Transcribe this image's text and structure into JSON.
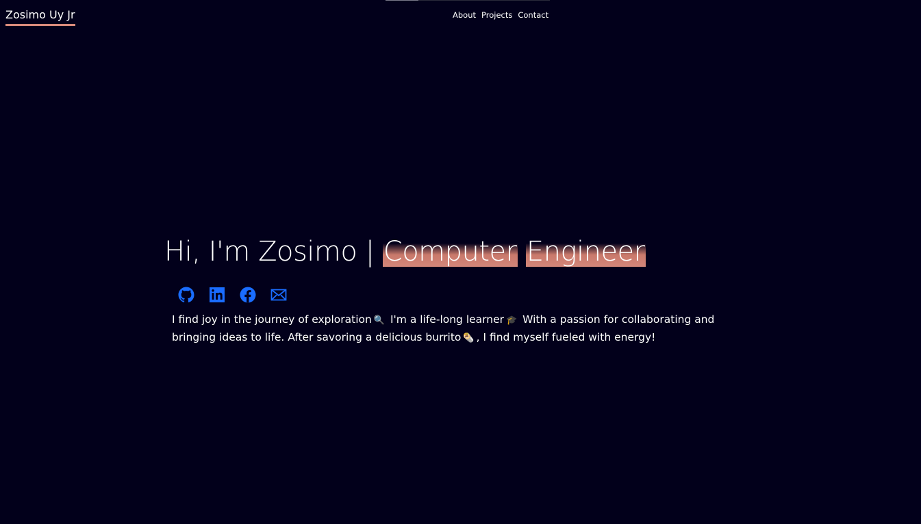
{
  "header": {
    "brand": "Zosimo Uy Jr",
    "nav": [
      {
        "label": "About"
      },
      {
        "label": "Projects"
      },
      {
        "label": "Contact"
      }
    ]
  },
  "scroll_progress": 0.2,
  "hero": {
    "greeting": "Hi, I'm Zosimo | ",
    "role_word_1": "Computer",
    "role_word_2": "Engineer",
    "socials": [
      {
        "icon": "github-icon"
      },
      {
        "icon": "linkedin-icon"
      },
      {
        "icon": "facebook-icon"
      },
      {
        "icon": "mail-icon"
      }
    ],
    "bio": {
      "part1": "I find joy in the journey of exploration",
      "emoji1": "🔍",
      "part2": " I'm a life-long learner",
      "emoji2": "🎓",
      "part3": " With a passion for collaborating and bringing ideas to life. After savoring a delicious burrito",
      "emoji3": "🌯",
      "part4": ", I find myself fueled with energy!"
    }
  },
  "colors": {
    "background": "#02001b",
    "accent": "#d3867a",
    "icon": "#1a6dff"
  }
}
